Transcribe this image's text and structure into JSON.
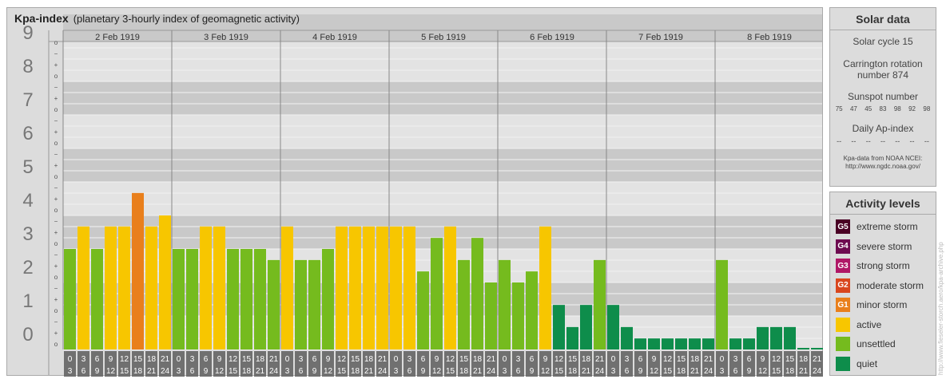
{
  "header": {
    "title": "Kpa-index",
    "subtitle": "(planetary 3-hourly index of geomagnetic activity)"
  },
  "chart_data": {
    "type": "bar",
    "title": "Kpa-index",
    "subtitle": "(planetary 3-hourly index of geomagnetic activity)",
    "days": [
      "2 Feb 1919",
      "3 Feb 1919",
      "4 Feb 1919",
      "5 Feb 1919",
      "6 Feb 1919",
      "7 Feb 1919",
      "8 Feb 1919"
    ],
    "y_ticks": [
      "0",
      "1",
      "2",
      "3",
      "4",
      "5",
      "6",
      "7",
      "8",
      "9"
    ],
    "sub_tick_marks": [
      "o",
      "+",
      "−"
    ],
    "ylim": [
      0,
      9.33
    ],
    "interval_starts": [
      "0",
      "3",
      "6",
      "9",
      "12",
      "15",
      "18",
      "21"
    ],
    "interval_ends": [
      "3",
      "6",
      "9",
      "12",
      "15",
      "18",
      "21",
      "24"
    ],
    "values": [
      3,
      3.67,
      3,
      3.67,
      3.67,
      4.67,
      3.67,
      4,
      3,
      3,
      3.67,
      3.67,
      3,
      3,
      3,
      2.67,
      3.67,
      2.67,
      2.67,
      3,
      3.67,
      3.67,
      3.67,
      3.67,
      3.67,
      3.67,
      2.33,
      3.33,
      3.67,
      2.67,
      3.33,
      2,
      2.67,
      2,
      2.33,
      3.67,
      1.33,
      0.67,
      1.33,
      2.67,
      1.33,
      0.67,
      0.33,
      0.33,
      0.33,
      0.33,
      0.33,
      0.33,
      2.67,
      0.33,
      0.33,
      0.67,
      0.67,
      0.67,
      0,
      0
    ],
    "colors": {
      "quiet": "#0e8d4b",
      "unsettled": "#75bb1e",
      "active": "#f7c600",
      "minor": "#e97f1c",
      "moderate": "#d9461e",
      "strong": "#b01766",
      "severe": "#6e0b50",
      "extreme": "#4a0024"
    }
  },
  "solar": {
    "title": "Solar data",
    "solar_cycle": "Solar cycle 15",
    "carrington_1": "Carrington rotation",
    "carrington_2": "number 874",
    "sunspot_title": "Sunspot number",
    "sunspot_values": [
      "75",
      "47",
      "45",
      "83",
      "98",
      "92",
      "98"
    ],
    "ap_title": "Daily Ap-index",
    "ap_values": [
      "--",
      "--",
      "--",
      "--",
      "--",
      "--",
      "--"
    ],
    "source_1": "Kpa-data from NOAA NCEI:",
    "source_2": "http://www.ngdc.noaa.gov/"
  },
  "activity": {
    "title": "Activity levels",
    "items": [
      {
        "badge": "G5",
        "label": "extreme storm",
        "color": "#4a0024"
      },
      {
        "badge": "G4",
        "label": "severe storm",
        "color": "#6e0b50"
      },
      {
        "badge": "G3",
        "label": "strong storm",
        "color": "#b01766"
      },
      {
        "badge": "G2",
        "label": "moderate storm",
        "color": "#d9461e"
      },
      {
        "badge": "G1",
        "label": "minor storm",
        "color": "#e97f1c"
      },
      {
        "badge": "",
        "label": "active",
        "color": "#f7c600"
      },
      {
        "badge": "",
        "label": "unsettled",
        "color": "#75bb1e"
      },
      {
        "badge": "",
        "label": "quiet",
        "color": "#0e8d4b"
      }
    ]
  },
  "credit": "http://www.fieseler-storch.aero/kpa-archive.php"
}
